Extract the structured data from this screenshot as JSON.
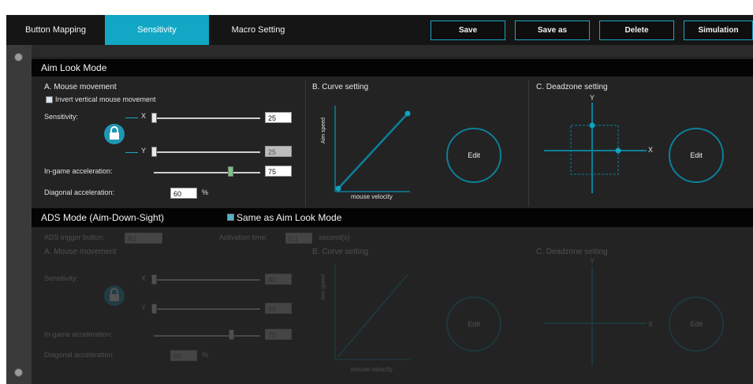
{
  "tabs": {
    "button_mapping": "Button Mapping",
    "sensitivity": "Sensitivity",
    "macro_setting": "Macro Setting"
  },
  "toolbar": {
    "save": "Save",
    "save_as": "Save as",
    "delete": "Delete",
    "simulation": "Simulation"
  },
  "aim": {
    "section_title": "Aim Look Mode",
    "mouse_movement": {
      "title": "A. Mouse movement",
      "invert_label": "Invert vertical mouse movement",
      "invert_checked": false,
      "sensitivity_label": "Sensitivity:",
      "x_label": "X",
      "y_label": "Y",
      "x_value": "25",
      "y_value": "25",
      "x_level": 0.0,
      "y_level": 0.0,
      "linked": true,
      "accel_label": "In-game acceleration:",
      "accel_value": "75",
      "accel_level": 0.75,
      "diag_label": "Diagonal acceleration:",
      "diag_value": "60",
      "diag_unit": "%"
    },
    "curve": {
      "title": "B. Curve setting",
      "ylabel": "Aim speed",
      "xlabel": "mouse velocity",
      "edit": "Edit"
    },
    "deadzone": {
      "title": "C. Deadzone setting",
      "y": "Y",
      "x": "X",
      "edit": "Edit"
    }
  },
  "ads": {
    "section_title": "ADS Mode (Aim-Down-Sight)",
    "same_as_label": "Same as Aim Look Mode",
    "same_as_checked": true,
    "button_label": "ADS trigger button:",
    "button_value": "R2",
    "release_label": "Activation time:",
    "release_value": "0.1",
    "release_unit": "second(s)",
    "mouse_movement": {
      "title": "A. Mouse movement",
      "sensitivity_label": "Sensitivity:",
      "x_label": "X",
      "y_label": "Y",
      "x_value": "40",
      "y_value": "40",
      "accel_label": "In-game acceleration:",
      "accel_value": "75",
      "diag_label": "Diagonal acceleration:",
      "diag_value": "60",
      "diag_unit": "%"
    },
    "curve": {
      "title": "B. Curve setting",
      "ylabel": "Aim speed",
      "xlabel": "mouse velocity",
      "edit": "Edit"
    },
    "deadzone": {
      "title": "C. Deadzone setting",
      "y": "Y",
      "x": "X",
      "edit": "Edit"
    }
  },
  "colors": {
    "accent": "#12a7c4",
    "ring": "#0d7f99",
    "toolbar_bg": "#151515",
    "panel_bg": "#232323"
  }
}
